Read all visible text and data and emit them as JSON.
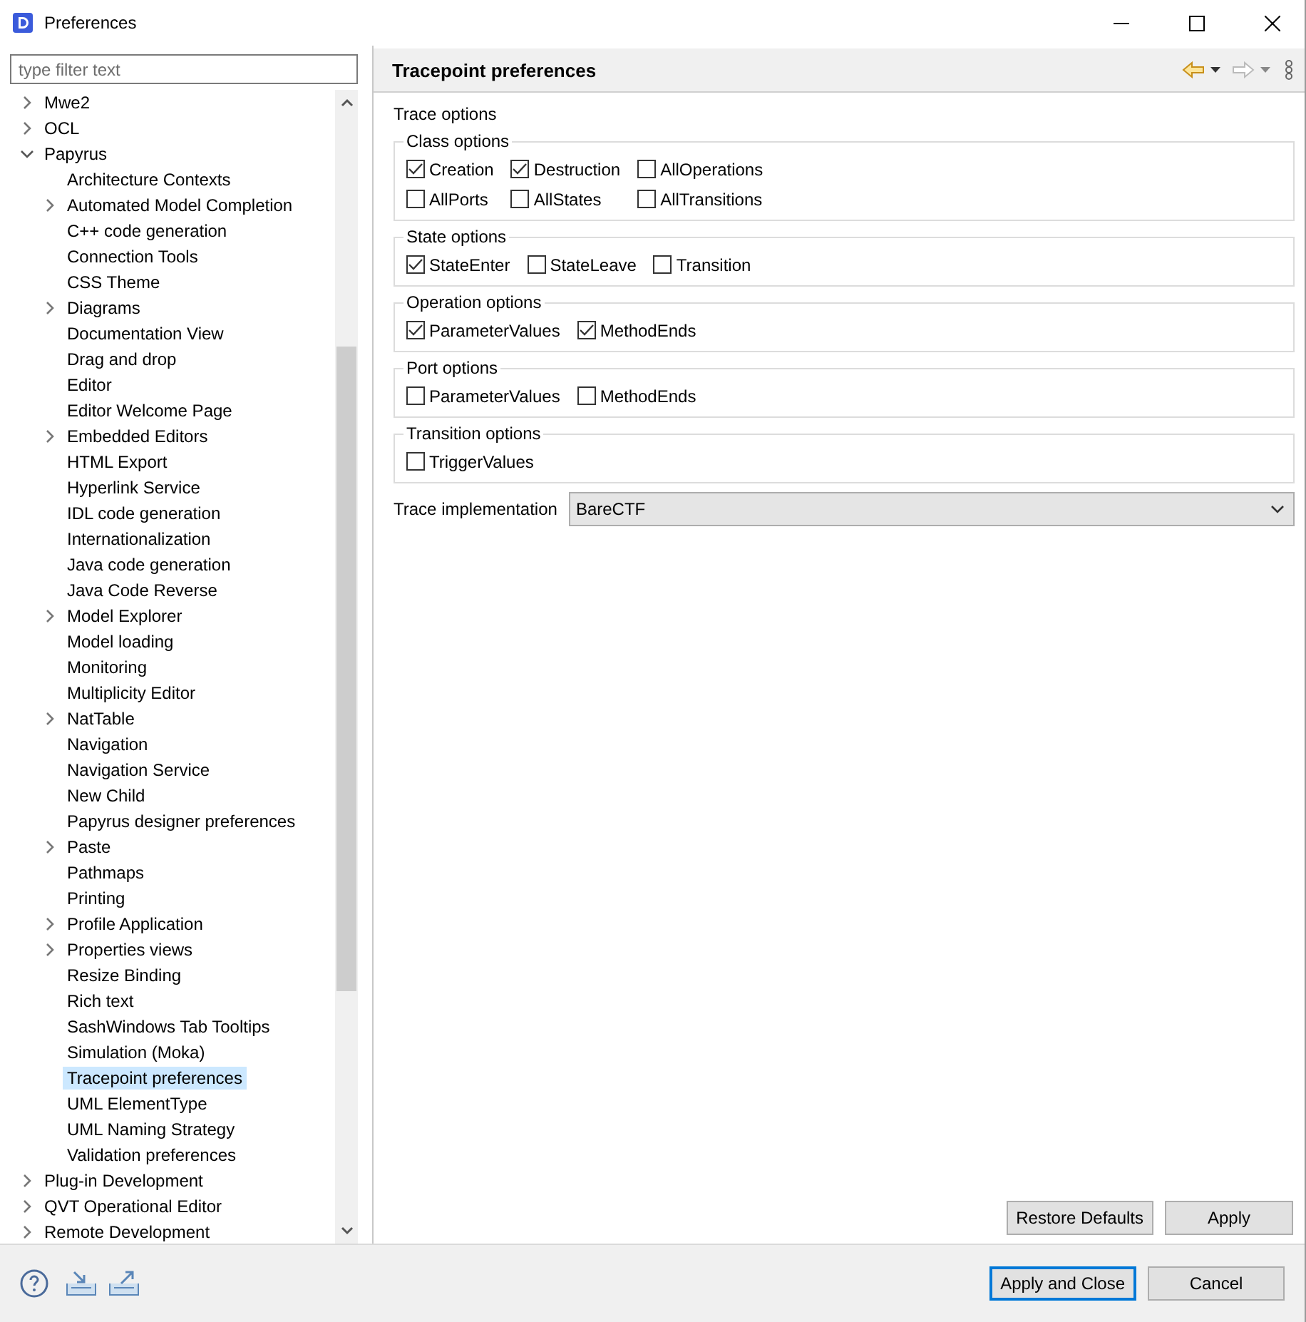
{
  "window": {
    "title": "Preferences"
  },
  "filter": {
    "placeholder": "type filter text"
  },
  "tree": [
    {
      "label": "Mwe2",
      "expanded": false,
      "selected": false
    },
    {
      "label": "OCL",
      "expanded": false,
      "selected": false
    },
    {
      "label": "Papyrus",
      "expanded": true,
      "selected": false,
      "children": [
        {
          "label": "Architecture Contexts",
          "selected": false
        },
        {
          "label": "Automated Model Completion",
          "expanded": false,
          "selected": false
        },
        {
          "label": "C++ code generation",
          "selected": false
        },
        {
          "label": "Connection Tools",
          "selected": false
        },
        {
          "label": "CSS Theme",
          "selected": false
        },
        {
          "label": "Diagrams",
          "expanded": false,
          "selected": false
        },
        {
          "label": "Documentation View",
          "selected": false
        },
        {
          "label": "Drag and drop",
          "selected": false
        },
        {
          "label": "Editor",
          "selected": false
        },
        {
          "label": "Editor Welcome Page",
          "selected": false
        },
        {
          "label": "Embedded Editors",
          "expanded": false,
          "selected": false
        },
        {
          "label": "HTML Export",
          "selected": false
        },
        {
          "label": "Hyperlink Service",
          "selected": false
        },
        {
          "label": "IDL code generation",
          "selected": false
        },
        {
          "label": "Internationalization",
          "selected": false
        },
        {
          "label": "Java code generation",
          "selected": false
        },
        {
          "label": "Java Code Reverse",
          "selected": false
        },
        {
          "label": "Model Explorer",
          "expanded": false,
          "selected": false
        },
        {
          "label": "Model loading",
          "selected": false
        },
        {
          "label": "Monitoring",
          "selected": false
        },
        {
          "label": "Multiplicity Editor",
          "selected": false
        },
        {
          "label": "NatTable",
          "expanded": false,
          "selected": false
        },
        {
          "label": "Navigation",
          "selected": false
        },
        {
          "label": "Navigation Service",
          "selected": false
        },
        {
          "label": "New Child",
          "selected": false
        },
        {
          "label": "Papyrus designer preferences",
          "selected": false
        },
        {
          "label": "Paste",
          "expanded": false,
          "selected": false
        },
        {
          "label": "Pathmaps",
          "selected": false
        },
        {
          "label": "Printing",
          "selected": false
        },
        {
          "label": "Profile Application",
          "expanded": false,
          "selected": false
        },
        {
          "label": "Properties views",
          "expanded": false,
          "selected": false
        },
        {
          "label": "Resize Binding",
          "selected": false
        },
        {
          "label": "Rich text",
          "selected": false
        },
        {
          "label": "SashWindows Tab Tooltips",
          "selected": false
        },
        {
          "label": "Simulation (Moka)",
          "selected": false
        },
        {
          "label": "Tracepoint preferences",
          "selected": true
        },
        {
          "label": "UML ElementType",
          "selected": false
        },
        {
          "label": "UML Naming Strategy",
          "selected": false
        },
        {
          "label": "Validation preferences",
          "selected": false
        }
      ]
    },
    {
      "label": "Plug-in Development",
      "expanded": false,
      "selected": false
    },
    {
      "label": "QVT Operational Editor",
      "expanded": false,
      "selected": false
    },
    {
      "label": "Remote Development",
      "expanded": false,
      "selected": false
    }
  ],
  "page": {
    "title": "Tracepoint preferences",
    "section": "Trace options",
    "groups": [
      {
        "title": "Class options",
        "options": [
          {
            "label": "Creation",
            "checked": true
          },
          {
            "label": "AllPorts",
            "checked": false
          },
          {
            "label": "Destruction",
            "checked": true
          },
          {
            "label": "AllStates",
            "checked": false
          },
          {
            "label": "AllOperations",
            "checked": false
          },
          {
            "label": "AllTransitions",
            "checked": false
          }
        ]
      },
      {
        "title": "State options",
        "options": [
          {
            "label": "StateEnter",
            "checked": true
          },
          {
            "label": "StateLeave",
            "checked": false
          },
          {
            "label": "Transition",
            "checked": false
          }
        ]
      },
      {
        "title": "Operation options",
        "options": [
          {
            "label": "ParameterValues",
            "checked": true
          },
          {
            "label": "MethodEnds",
            "checked": true
          }
        ]
      },
      {
        "title": "Port options",
        "options": [
          {
            "label": "ParameterValues",
            "checked": false
          },
          {
            "label": "MethodEnds",
            "checked": false
          }
        ]
      },
      {
        "title": "Transition options",
        "options": [
          {
            "label": "TriggerValues",
            "checked": false
          }
        ]
      }
    ],
    "implementation": {
      "label": "Trace implementation",
      "value": "BareCTF"
    },
    "buttons": [
      "Restore Defaults",
      "Apply"
    ]
  },
  "footer": {
    "buttons": [
      {
        "label": "Apply and Close",
        "default": true
      },
      {
        "label": "Cancel",
        "default": false
      }
    ]
  }
}
